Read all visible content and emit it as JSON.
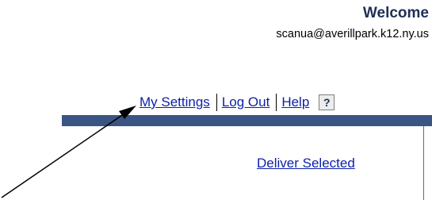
{
  "header": {
    "welcome_title": "Welcome",
    "user_email": "scanua@averillpark.k12.ny.us"
  },
  "top_links": {
    "my_settings": "My Settings",
    "log_out": "Log Out",
    "help": "Help",
    "help_icon_glyph": "?"
  },
  "actions": {
    "deliver_selected": "Deliver Selected"
  },
  "colors": {
    "nav_bar": "#3a5584",
    "link": "#0b1fa8",
    "welcome_text": "#1f2f55"
  },
  "icons": {
    "help": "question-mark-icon",
    "annotation": "annotation-arrow"
  }
}
